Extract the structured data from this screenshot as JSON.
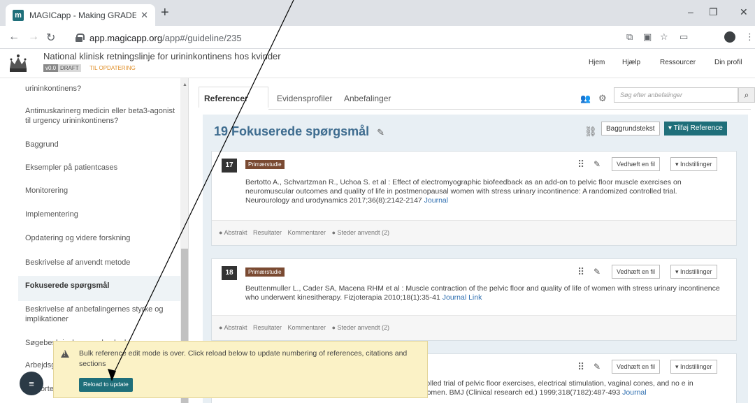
{
  "browser": {
    "tab_title": "MAGICapp - Making GRADE the",
    "favicon_letter": "m",
    "tab_close": "✕",
    "new_tab": "+",
    "url_host": "app.magicapp.org",
    "url_path": "/app#/guideline/235",
    "win_min": "–",
    "win_max": "❐",
    "win_close": "✕"
  },
  "header": {
    "title": "National klinisk retningslinje for urininkontinens hos kvinder",
    "version": "v0.0",
    "status": "DRAFT",
    "update_label": "TIL OPDATERING",
    "nav": [
      "Hjem",
      "Hjælp",
      "Ressourcer",
      "Din profil"
    ]
  },
  "sidebar": {
    "items": [
      "urininkontinens?",
      "Antimuskarinerg medicin eller beta3-agonist til urgency urininkontinens?",
      "Baggrund",
      "Eksempler på patientcases",
      "Monitorering",
      "Implementering",
      "Opdatering og videre forskning",
      "Beskrivelse af anvendt metode",
      "Fokuserede spørgsmål",
      "Beskrivelse af anbefalingernes styrke og implikationer",
      "Søgebeskrivelse og udvælgelse",
      "Arbejdsgruppe",
      "Forkortelser"
    ]
  },
  "main": {
    "tabs": [
      "Referencer",
      "Evidensprofiler",
      "Anbefalinger"
    ],
    "search_placeholder": "Søg efter anbefalinger",
    "section_number": "19",
    "section_title": "Fokuserede spørgsmål",
    "background_btn": "Baggrundstekst",
    "add_ref_btn": "▾ Tilføj Reference",
    "attach_btn": "Vedhæft en fil",
    "settings_btn": "▾ Indstillinger",
    "footer_items": [
      "● Abstrakt",
      "Resultater",
      "Kommentarer",
      "● Steder anvendt (2)"
    ],
    "references": [
      {
        "number": "17",
        "type": "Primærstudie",
        "text": "Bertotto A., Schvartzman R., Uchoa S. et al : Effect of electromyographic biofeedback as an add-on to pelvic floor muscle exercises on neuromuscular outcomes and quality of life in postmenopausal women with stress urinary incontinence: A randomized controlled trial. Neurourology and urodynamics 2017;36(8):2142-2147 ",
        "links": "Journal"
      },
      {
        "number": "18",
        "type": "Primærstudie",
        "text": "Beuttenmuller L., Cader SA, Macena RHM et al : Muscle contraction of the pelvic floor and quality of life of women with stress urinary incontinence who underwent kinesitherapy. Fizjoterapia 2010;18(1):35-41 ",
        "links": "Journal Link"
      },
      {
        "number": "",
        "type": "",
        "text": "trolled trial of pelvic floor exercises, electrical stimulation, vaginal cones, and no e in women. BMJ (Clinical research ed.) 1999;318(7182):487-493 ",
        "links": "Journal"
      }
    ]
  },
  "toast": {
    "message": "Bulk reference edit mode is over. Click reload below to update numbering of references, citations and sections",
    "button": "Reload to update"
  }
}
